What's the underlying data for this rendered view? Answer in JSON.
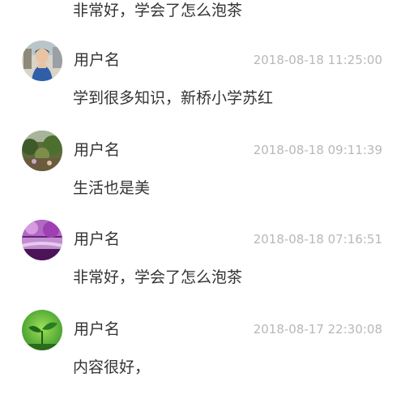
{
  "top_partial": {
    "content": "非常好，学会了怎么泡茶"
  },
  "comments": [
    {
      "username": "用户名",
      "timestamp": "2018-08-18 11:25:00",
      "content": "学到很多知识，新桥小学苏红",
      "avatar_icon": "photo-avatar-woman-blue-shirt"
    },
    {
      "username": "用户名",
      "timestamp": "2018-08-18 09:11:39",
      "content": "生活也是美",
      "avatar_icon": "photo-avatar-garden"
    },
    {
      "username": "用户名",
      "timestamp": "2018-08-18 07:16:51",
      "content": "非常好，学会了怎么泡茶",
      "avatar_icon": "photo-avatar-purple-lake"
    },
    {
      "username": "用户名",
      "timestamp": "2018-08-17 22:30:08",
      "content": "内容很好，",
      "avatar_icon": "photo-avatar-green-sprout"
    }
  ]
}
